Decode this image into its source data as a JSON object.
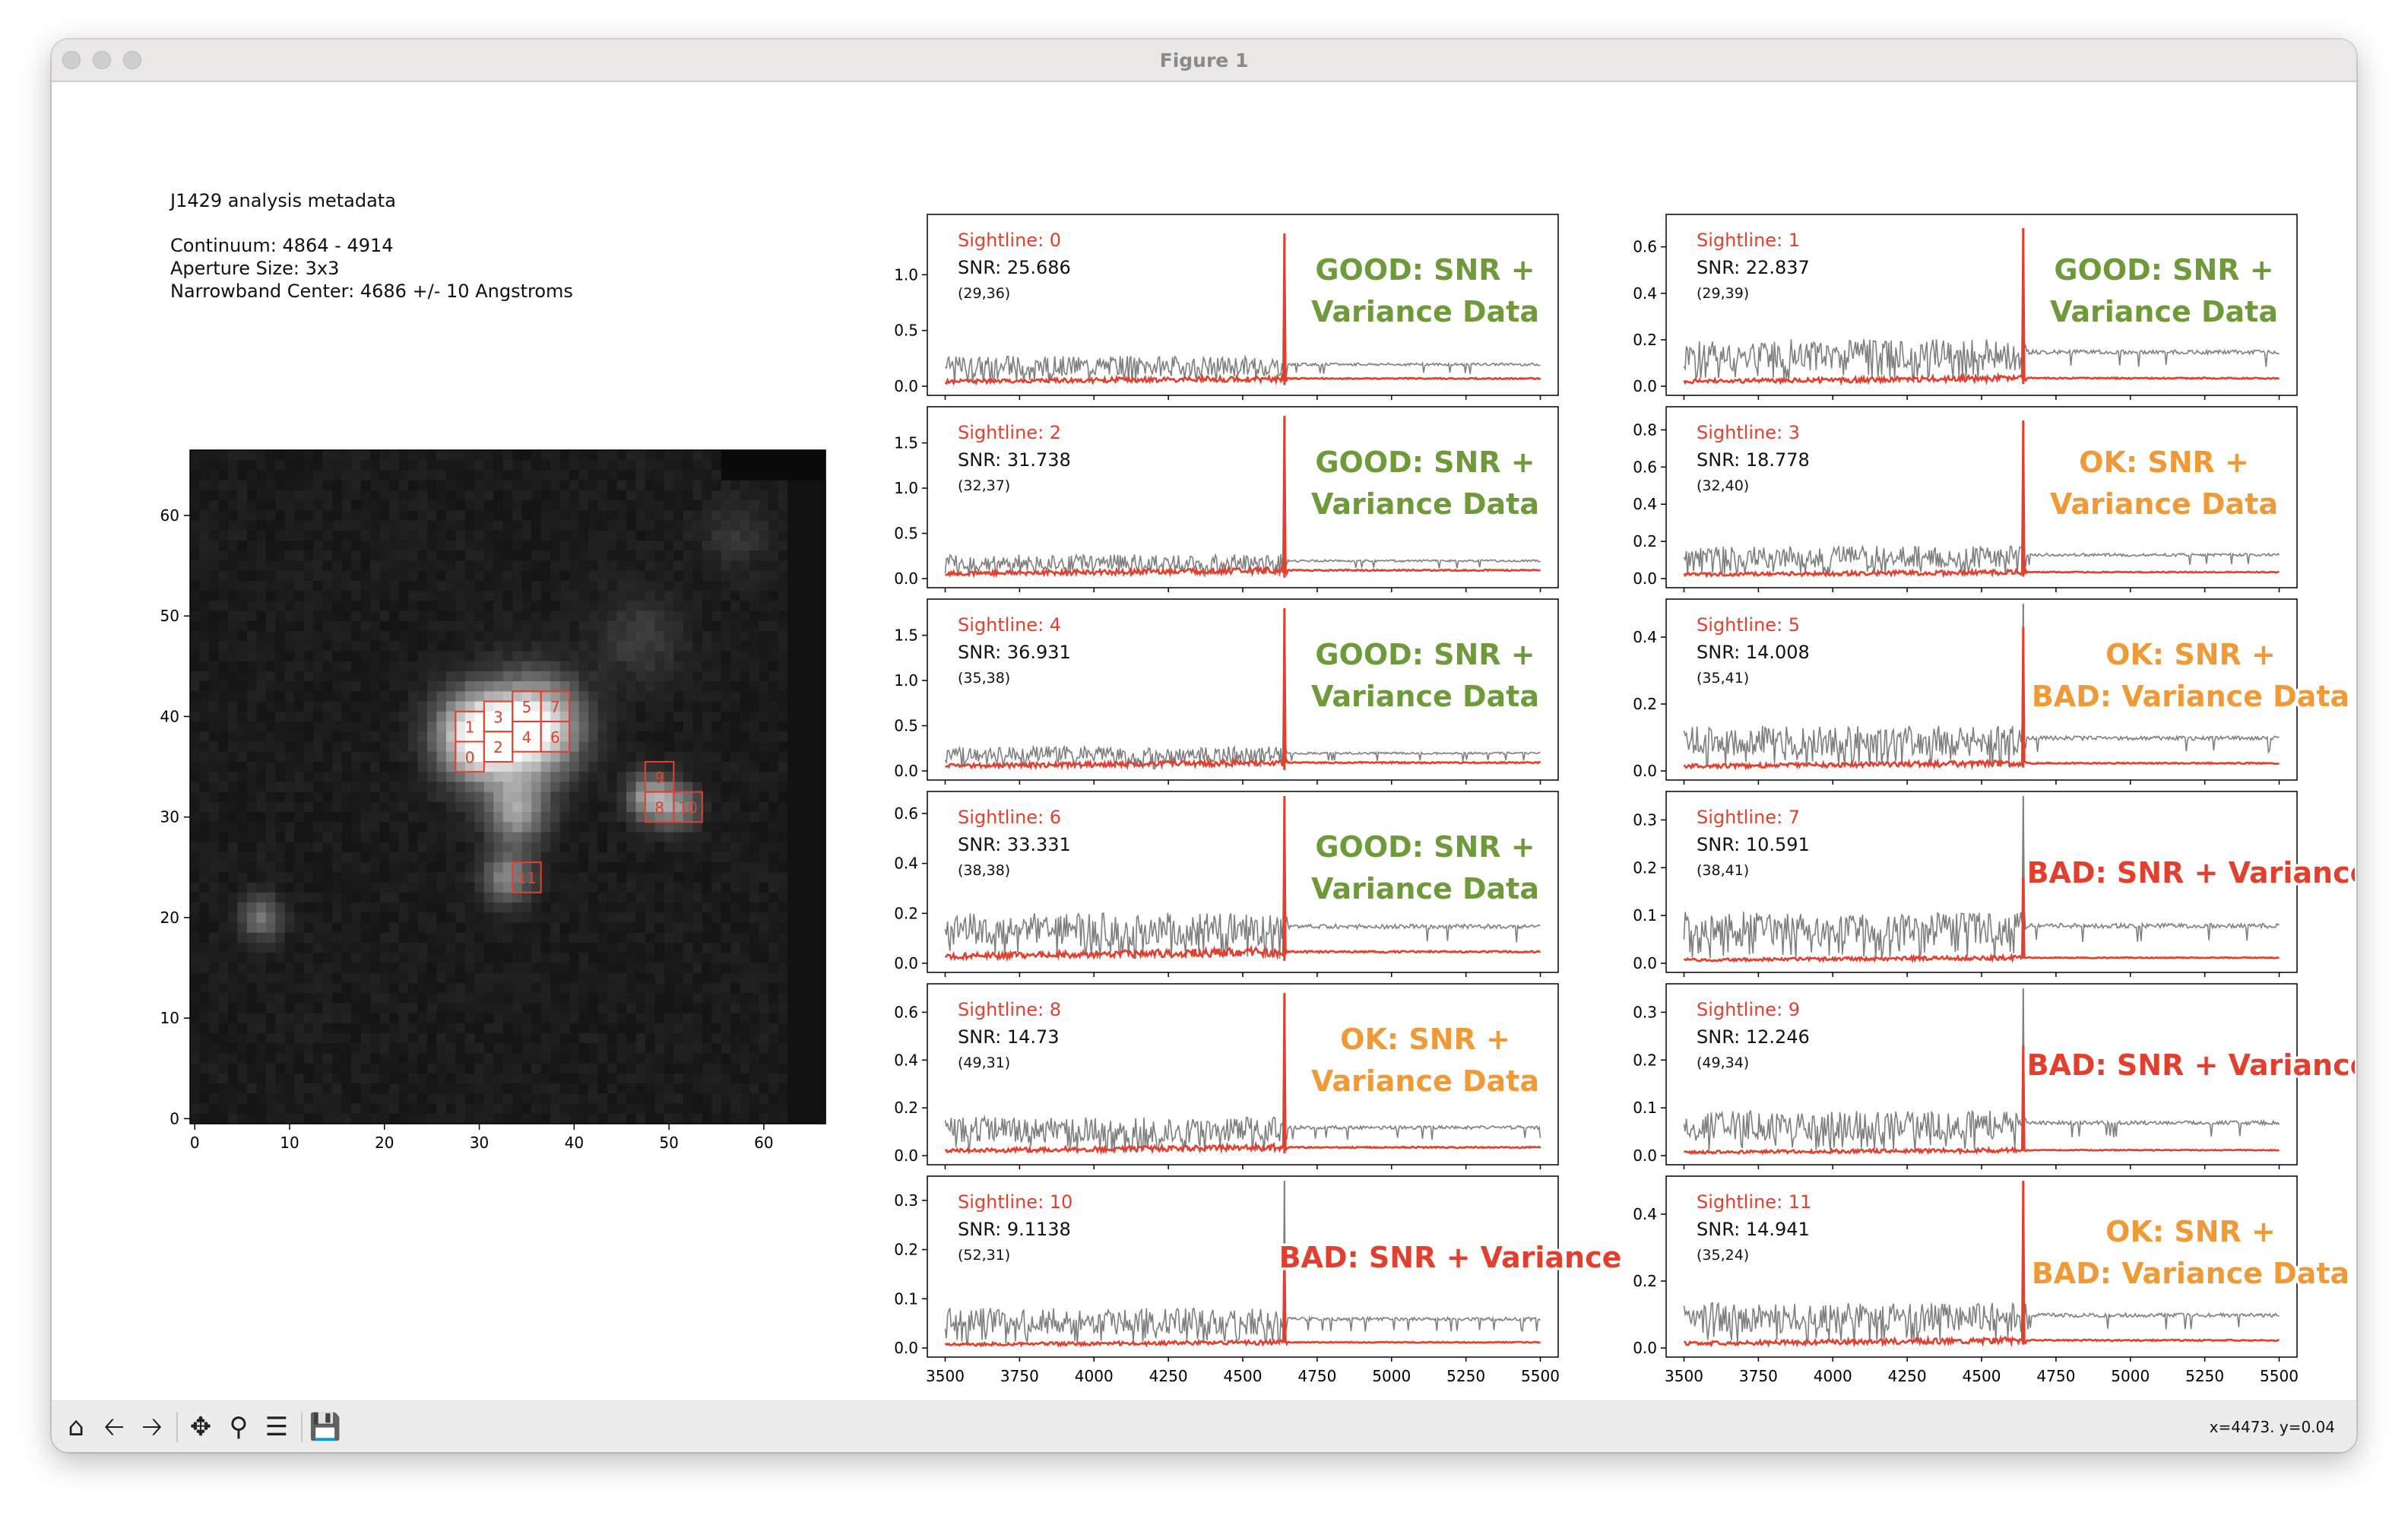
{
  "window": {
    "title": "Figure 1"
  },
  "metadata": {
    "title": "J1429 analysis metadata",
    "continuum": "Continuum: 4864 - 4914",
    "aperture": "Aperture Size: 3x3",
    "narrowband": "Narrowband Center: 4686 +/- 10 Angstroms"
  },
  "image_panel": {
    "xticks": [
      "0",
      "10",
      "20",
      "30",
      "40",
      "50",
      "60"
    ],
    "yticks": [
      "0",
      "10",
      "20",
      "30",
      "40",
      "50",
      "60"
    ],
    "box_labels": [
      "0",
      "1",
      "2",
      "3",
      "4",
      "5",
      "6",
      "7",
      "8",
      "9",
      "10",
      "11"
    ]
  },
  "spectra_xticks": [
    "3500",
    "3750",
    "4000",
    "4250",
    "4500",
    "4750",
    "5000",
    "5250",
    "5500"
  ],
  "colors": {
    "good": "#6e9a3a",
    "ok": "#ef9a37",
    "bad": "#e2402f",
    "series_flux": "#e2402f",
    "series_var": "#7f7f7f"
  },
  "chart_data": [
    {
      "type": "line",
      "sightline": "Sightline: 0",
      "snr": "SNR: 25.686",
      "coord": "(29,36)",
      "verdict_lines": [
        "GOOD: SNR +",
        "Variance Data"
      ],
      "verdict_class": "good",
      "yticks": [
        "0.0",
        "0.5",
        "1.0"
      ],
      "ylim": [
        0,
        1.5
      ],
      "peak_x": 4640,
      "peak_red": 1.37,
      "peak_gray": 1.37,
      "gray_level": 0.2,
      "red_level": 0.06
    },
    {
      "type": "line",
      "sightline": "Sightline: 1",
      "snr": "SNR: 22.837",
      "coord": "(29,39)",
      "verdict_lines": [
        "GOOD: SNR +",
        "Variance Data"
      ],
      "verdict_class": "good",
      "yticks": [
        "0.0",
        "0.2",
        "0.4",
        "0.6"
      ],
      "ylim": [
        0,
        0.72
      ],
      "peak_x": 4640,
      "peak_red": 0.68,
      "peak_gray": 0.68,
      "gray_level": 0.15,
      "red_level": 0.03
    },
    {
      "type": "line",
      "sightline": "Sightline: 2",
      "snr": "SNR: 31.738",
      "coord": "(32,37)",
      "verdict_lines": [
        "GOOD: SNR +",
        "Variance Data"
      ],
      "verdict_class": "good",
      "yticks": [
        "0.0",
        "0.5",
        "1.0",
        "1.5"
      ],
      "ylim": [
        0,
        1.85
      ],
      "peak_x": 4640,
      "peak_red": 1.8,
      "peak_gray": 1.8,
      "gray_level": 0.2,
      "red_level": 0.08
    },
    {
      "type": "line",
      "sightline": "Sightline: 3",
      "snr": "SNR: 18.778",
      "coord": "(32,40)",
      "verdict_lines": [
        "OK: SNR +",
        "Variance Data"
      ],
      "verdict_class": "ok",
      "yticks": [
        "0.0",
        "0.2",
        "0.4",
        "0.6",
        "0.8"
      ],
      "ylim": [
        0,
        0.9
      ],
      "peak_x": 4640,
      "peak_red": 0.85,
      "peak_gray": 0.85,
      "gray_level": 0.13,
      "red_level": 0.03
    },
    {
      "type": "line",
      "sightline": "Sightline: 4",
      "snr": "SNR: 36.931",
      "coord": "(35,38)",
      "verdict_lines": [
        "GOOD: SNR +",
        "Variance Data"
      ],
      "verdict_class": "good",
      "yticks": [
        "0.0",
        "0.5",
        "1.0",
        "1.5"
      ],
      "ylim": [
        0,
        1.85
      ],
      "peak_x": 4640,
      "peak_red": 1.8,
      "peak_gray": 1.8,
      "gray_level": 0.2,
      "red_level": 0.08
    },
    {
      "type": "line",
      "sightline": "Sightline: 5",
      "snr": "SNR: 14.008",
      "coord": "(35,41)",
      "verdict_lines": [
        "OK: SNR +",
        "BAD: Variance Data"
      ],
      "verdict_class": "ok",
      "yticks": [
        "0.0",
        "0.2",
        "0.4"
      ],
      "ylim": [
        0,
        0.5
      ],
      "peak_x": 4640,
      "peak_red": 0.43,
      "peak_gray": 0.5,
      "gray_level": 0.1,
      "red_level": 0.02
    },
    {
      "type": "line",
      "sightline": "Sightline: 6",
      "snr": "SNR: 33.331",
      "coord": "(38,38)",
      "verdict_lines": [
        "GOOD: SNR +",
        "Variance Data"
      ],
      "verdict_class": "good",
      "yticks": [
        "0.0",
        "0.2",
        "0.4",
        "0.6"
      ],
      "ylim": [
        0,
        0.67
      ],
      "peak_x": 4640,
      "peak_red": 0.67,
      "peak_gray": 0.67,
      "gray_level": 0.15,
      "red_level": 0.04
    },
    {
      "type": "line",
      "sightline": "Sightline: 7",
      "snr": "SNR: 10.591",
      "coord": "(38,41)",
      "verdict_lines": [
        "BAD: SNR + Variance"
      ],
      "verdict_class": "bad",
      "yticks": [
        "0.0",
        "0.1",
        "0.2",
        "0.3"
      ],
      "ylim": [
        0,
        0.35
      ],
      "peak_x": 4640,
      "peak_red": 0.18,
      "peak_gray": 0.35,
      "gray_level": 0.08,
      "red_level": 0.01
    },
    {
      "type": "line",
      "sightline": "Sightline: 8",
      "snr": "SNR: 14.73",
      "coord": "(49,31)",
      "verdict_lines": [
        "OK: SNR +",
        "Variance Data"
      ],
      "verdict_class": "ok",
      "yticks": [
        "0.0",
        "0.2",
        "0.4",
        "0.6"
      ],
      "ylim": [
        0,
        0.7
      ],
      "peak_x": 4640,
      "peak_red": 0.68,
      "peak_gray": 0.68,
      "gray_level": 0.12,
      "red_level": 0.03
    },
    {
      "type": "line",
      "sightline": "Sightline: 9",
      "snr": "SNR: 12.246",
      "coord": "(49,34)",
      "verdict_lines": [
        "BAD: SNR + Variance"
      ],
      "verdict_class": "bad",
      "yticks": [
        "0.0",
        "0.1",
        "0.2",
        "0.3"
      ],
      "ylim": [
        0,
        0.35
      ],
      "peak_x": 4640,
      "peak_red": 0.23,
      "peak_gray": 0.35,
      "gray_level": 0.07,
      "red_level": 0.01
    },
    {
      "type": "line",
      "sightline": "Sightline: 10",
      "snr": "SNR: 9.1138",
      "coord": "(52,31)",
      "verdict_lines": [
        "BAD: SNR + Variance"
      ],
      "verdict_class": "bad",
      "yticks": [
        "0.0",
        "0.1",
        "0.2",
        "0.3"
      ],
      "ylim": [
        0,
        0.34
      ],
      "peak_x": 4640,
      "peak_red": 0.21,
      "peak_gray": 0.34,
      "gray_level": 0.06,
      "red_level": 0.01
    },
    {
      "type": "line",
      "sightline": "Sightline: 11",
      "snr": "SNR: 14.941",
      "coord": "(35,24)",
      "verdict_lines": [
        "OK: SNR +",
        "BAD: Variance Data"
      ],
      "verdict_class": "ok",
      "yticks": [
        "0.0",
        "0.2",
        "0.4"
      ],
      "ylim": [
        0,
        0.5
      ],
      "peak_x": 4640,
      "peak_red": 0.5,
      "peak_gray": 0.5,
      "gray_level": 0.1,
      "red_level": 0.02
    }
  ],
  "status": {
    "coords": "x=4473. y=0.04"
  },
  "toolbar": [
    {
      "name": "home-button",
      "icon": "home-icon"
    },
    {
      "name": "back-button",
      "icon": "back-arrow-icon"
    },
    {
      "name": "forward-button",
      "icon": "forward-arrow-icon"
    },
    {
      "name": "pan-button",
      "icon": "move-icon"
    },
    {
      "name": "zoom-button",
      "icon": "magnifier-icon"
    },
    {
      "name": "configure-subplots-button",
      "icon": "sliders-icon"
    },
    {
      "name": "save-button",
      "icon": "floppy-disk-icon"
    }
  ]
}
